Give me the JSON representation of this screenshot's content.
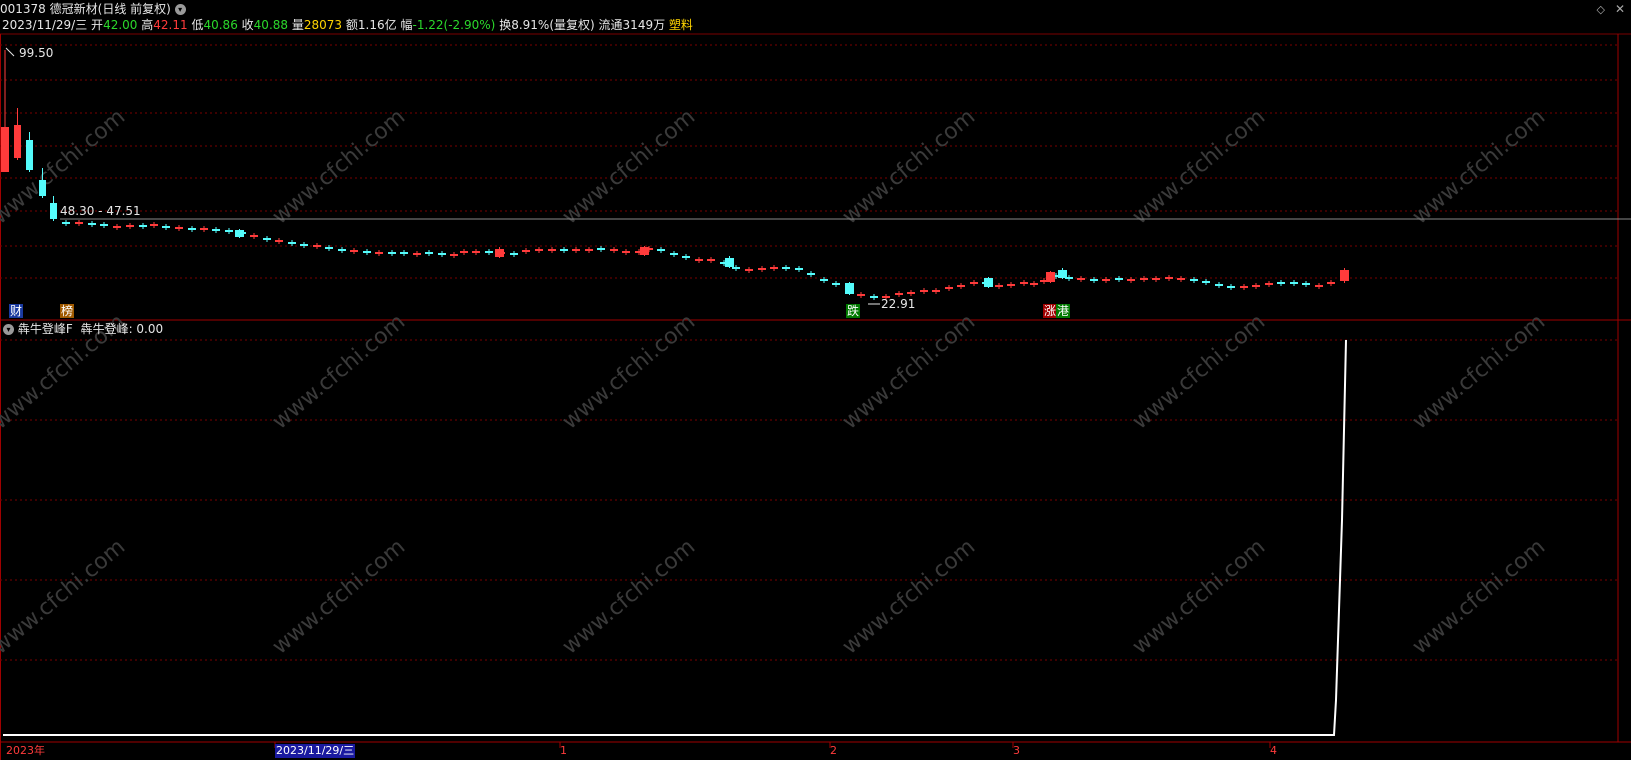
{
  "header": {
    "code": "001378",
    "name": "德冠新材",
    "period": "(日线 前复权)",
    "date": "2023/11/29/三",
    "open_label": "开",
    "open": "42.00",
    "high_label": "高",
    "high": "42.11",
    "low_label": "低",
    "low": "40.86",
    "close_label": "收",
    "close": "40.88",
    "vol_label": "量",
    "vol": "28073",
    "amount_label": "额",
    "amount": "1.16亿",
    "change_label": "幅",
    "change": "-1.22(-2.90%)",
    "turnover_label": "换",
    "turnover": "8.91%(量复权)",
    "float_label": "流通",
    "float": "3149万",
    "industry": "塑料"
  },
  "price_chart": {
    "max_label": "99.50",
    "range_label": "48.30 - 47.51",
    "min_label": "22.91",
    "tags": {
      "cai": "财",
      "bang": "榜",
      "die": "跌",
      "zhang": "涨",
      "gang": "港"
    }
  },
  "indicator": {
    "name": "犇牛登峰F",
    "value_text": "犇牛登峰: 0.00"
  },
  "x_axis": {
    "labels": [
      "2023年",
      "2023/11/29/三",
      "1",
      "2",
      "3",
      "4"
    ]
  },
  "watermark": "www.cfchi.com",
  "colors": {
    "bg": "#000000",
    "up": "#ff3b3b",
    "down": "#54fcfc",
    "grid": "#7a0000",
    "indicator_line": "#ffffff"
  },
  "chart_data": {
    "type": "candlestick",
    "price_range": [
      22.91,
      99.5
    ],
    "indicator_series": {
      "name": "犇牛登峰",
      "last_value": 0.0
    }
  }
}
